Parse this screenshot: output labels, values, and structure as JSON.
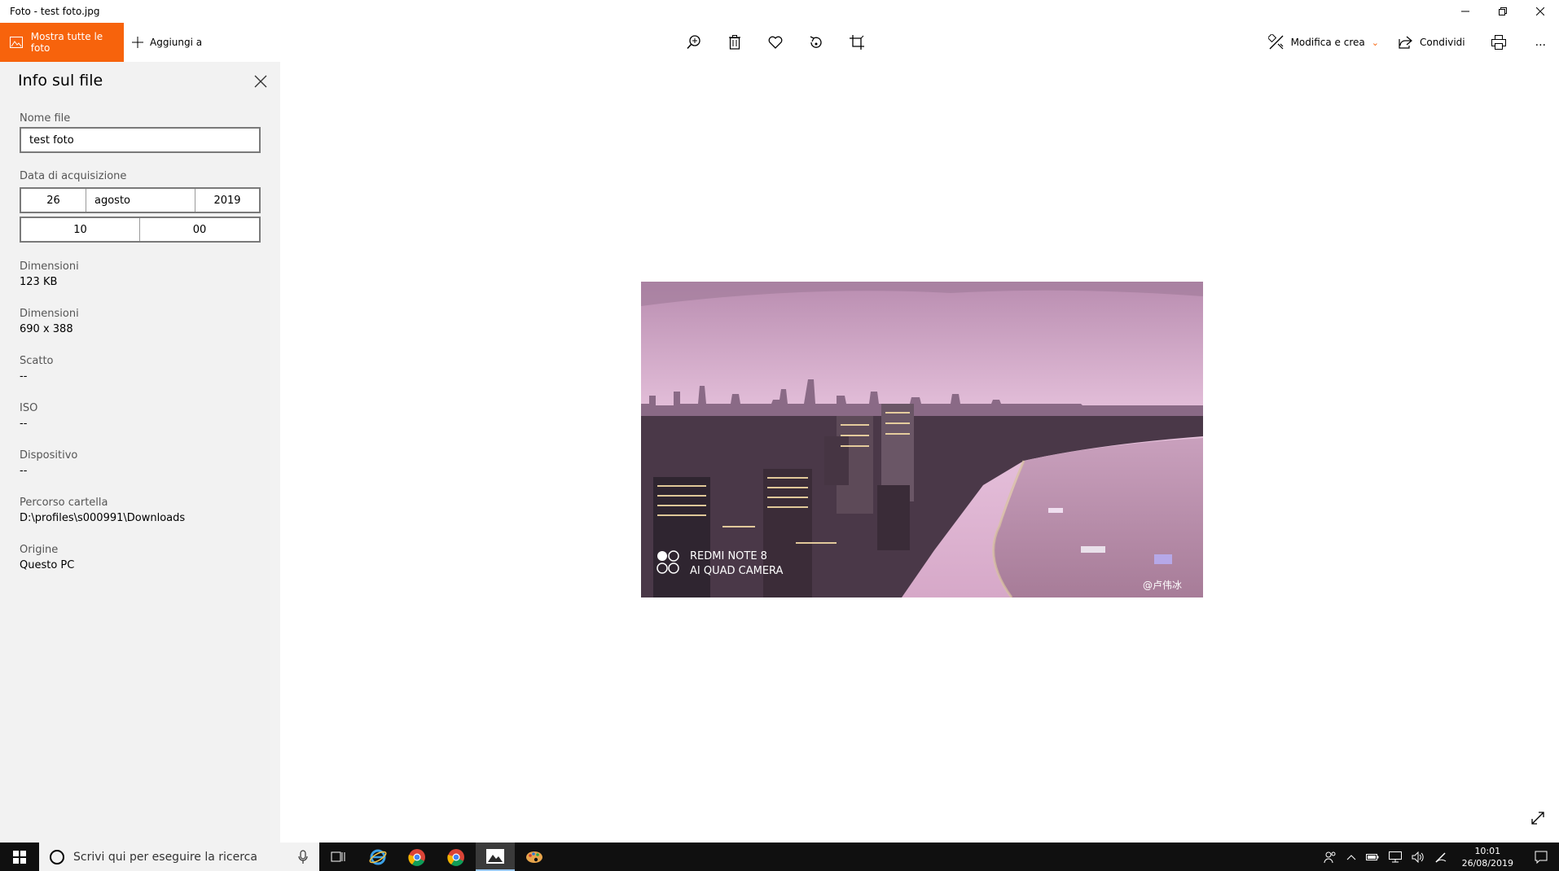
{
  "window": {
    "title": "Foto - test foto.jpg"
  },
  "toolbar": {
    "show_all_label": "Mostra tutte le foto",
    "add_to_label": "Aggiungi a",
    "edit_create_label": "Modifica e crea",
    "share_label": "Condividi",
    "more_label": "..."
  },
  "panel": {
    "title": "Info sul file",
    "filename_label": "Nome file",
    "filename_value": "test foto",
    "date_label": "Data di acquisizione",
    "date_day": "26",
    "date_month": "agosto",
    "date_year": "2019",
    "time_hour": "10",
    "time_minute": "00",
    "size_label": "Dimensioni",
    "size_value": "123 KB",
    "dimensions_label": "Dimensioni",
    "dimensions_value": "690 x 388",
    "shot_label": "Scatto",
    "shot_value": "--",
    "iso_label": "ISO",
    "iso_value": "--",
    "device_label": "Dispositivo",
    "device_value": "--",
    "folder_label": "Percorso cartella",
    "folder_value": "D:\\profiles\\s000991\\Downloads",
    "origin_label": "Origine",
    "origin_value": "Questo PC"
  },
  "photo": {
    "watermark_line1": "REDMI NOTE 8",
    "watermark_line2": "AI QUAD CAMERA",
    "credit": "@卢伟冰"
  },
  "taskbar": {
    "search_placeholder": "Scrivi qui per eseguire la ricerca",
    "time": "10:01",
    "date": "26/08/2019"
  },
  "colors": {
    "accent": "#f7630c",
    "panel_bg": "#f2f2f2",
    "taskbar_bg": "#101010"
  }
}
